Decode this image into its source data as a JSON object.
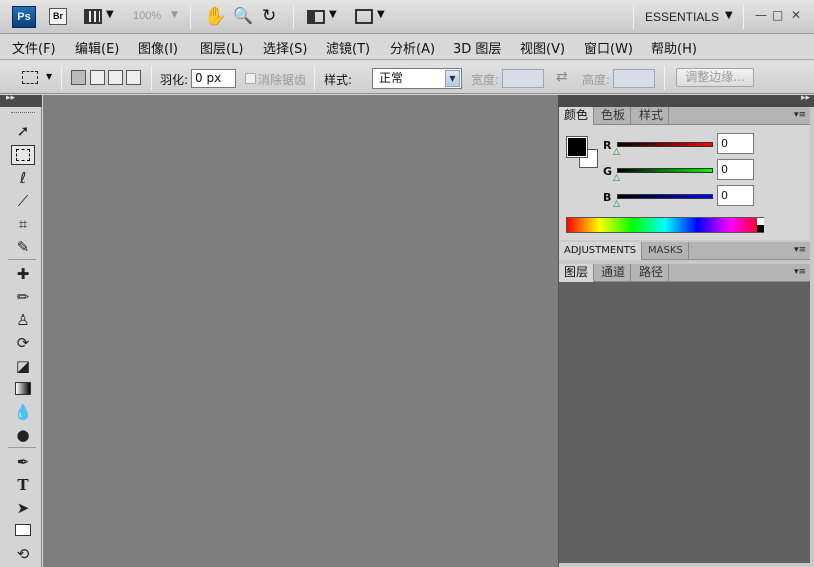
{
  "app": {
    "icon": "Ps",
    "bridge": "Br",
    "zoom": "100%",
    "workspace": "ESSENTIALS"
  },
  "menu": [
    "文件(F)",
    "编辑(E)",
    "图像(I)",
    "图层(L)",
    "选择(S)",
    "滤镜(T)",
    "分析(A)",
    "3D 图层",
    "视图(V)",
    "窗口(W)",
    "帮助(H)"
  ],
  "options": {
    "feather_label": "羽化:",
    "feather_value": "0 px",
    "antialias_label": "消除锯齿",
    "style_label": "样式:",
    "style_value": "正常",
    "width_label": "宽度:",
    "height_label": "高度:",
    "refine_button": "调整边缘..."
  },
  "panels": {
    "color_tabs": [
      "颜色",
      "色板",
      "样式"
    ],
    "r_label": "R",
    "g_label": "G",
    "b_label": "B",
    "r": "0",
    "g": "0",
    "b": "0",
    "adjust_tabs": [
      "ADJUSTMENTS",
      "MASKS"
    ],
    "layers_tabs": [
      "图层",
      "通道",
      "路径"
    ]
  },
  "colors": {
    "canvas": "#7f7f7f",
    "layers_bg": "#616161",
    "accent": "#0b3f7a"
  }
}
